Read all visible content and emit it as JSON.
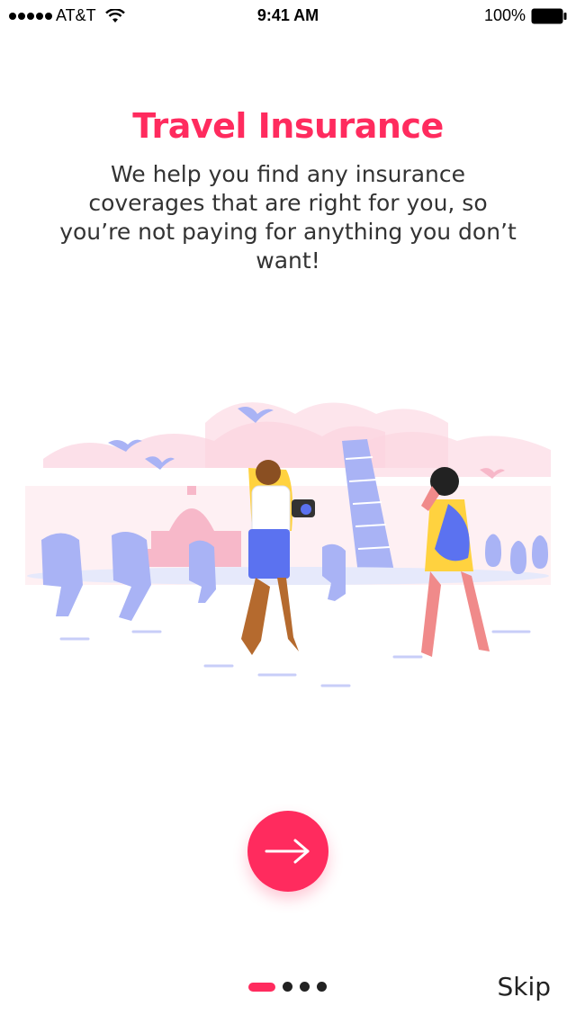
{
  "status_bar": {
    "carrier": "AT&T",
    "time": "9:41 AM",
    "battery": "100%"
  },
  "onboarding": {
    "title": "Travel Insurance",
    "description": "We help you find any insurance coverages that are right for you, so you’re not paying for anything you don’t want!",
    "skip_label": "Skip",
    "pager": {
      "total": 4,
      "active": 1
    }
  },
  "colors": {
    "accent": "#ff2b5e",
    "illustration_sky": "#fbd3df",
    "illustration_figures": "#a9b3f5"
  },
  "icons": {
    "next": "arrow-right-icon",
    "wifi": "wifi-icon",
    "battery": "battery-icon"
  }
}
